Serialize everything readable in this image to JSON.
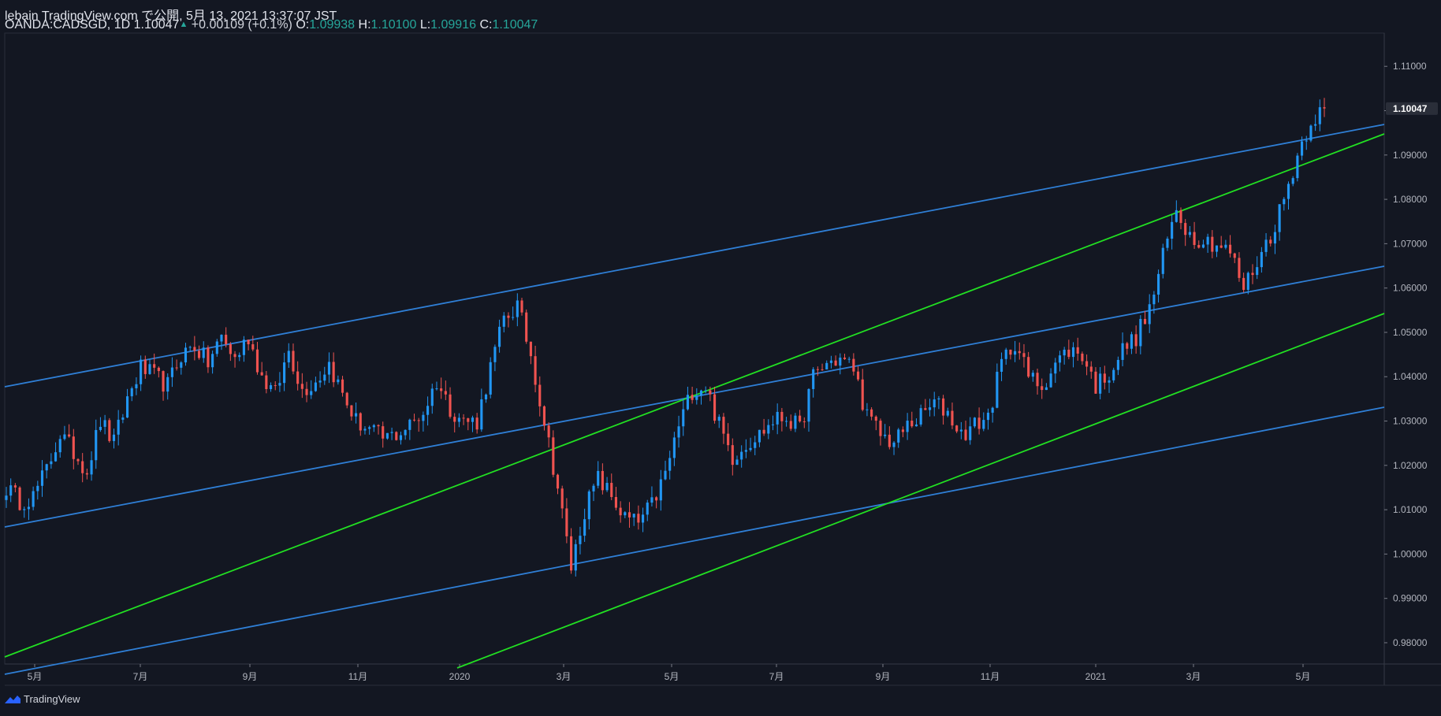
{
  "header": {
    "publish_line": "lebain TradingView.com で公開, 5月 13, 2021 13:37:07 JST",
    "symbol": "OANDA:CADSGD, 1D",
    "last": "1.10047",
    "change": "+0.00109 (+0.1%)",
    "o_label": "O:",
    "o_value": "1.09938",
    "h_label": "H:",
    "h_value": "1.10100",
    "l_label": "L:",
    "l_value": "1.09916",
    "c_label": "C:",
    "c_value": "1.10047"
  },
  "footer": {
    "logo_text": "TradingView"
  },
  "colors": {
    "background": "#131722",
    "up": "#2196f3",
    "down": "#f05350",
    "channel_blue": "#2f7fd6",
    "channel_green": "#22e022",
    "value_green": "#26a69a"
  },
  "chart_data": {
    "type": "candlestick",
    "ylim": [
      0.9752,
      1.1175
    ],
    "y_ticks": [
      "1.11000",
      "1.10000",
      "1.09000",
      "1.08000",
      "1.07000",
      "1.06000",
      "1.05000",
      "1.04000",
      "1.03000",
      "1.02000",
      "1.01000",
      "1.00000",
      "0.99000",
      "0.98000"
    ],
    "x_ticks": [
      "5月",
      "7月",
      "9月",
      "11月",
      "2020",
      "3月",
      "5月",
      "7月",
      "9月",
      "11月",
      "2021",
      "3月",
      "5月"
    ],
    "current_price_label": "1.10047",
    "series": [
      {
        "points": [
          [
            0,
            1.015
          ],
          [
            3,
            1.012
          ],
          [
            6,
            1.013
          ],
          [
            9,
            1.019
          ],
          [
            12,
            1.027
          ],
          [
            15,
            1.023
          ],
          [
            18,
            1.019
          ],
          [
            21,
            1.03
          ],
          [
            24,
            1.025
          ],
          [
            27,
            1.035
          ],
          [
            30,
            1.042
          ],
          [
            33,
            1.04
          ],
          [
            36,
            1.038
          ],
          [
            39,
            1.045
          ],
          [
            42,
            1.047
          ],
          [
            45,
            1.043
          ],
          [
            48,
            1.049
          ],
          [
            51,
            1.044
          ],
          [
            54,
            1.049
          ],
          [
            57,
            1.04
          ],
          [
            60,
            1.036
          ],
          [
            63,
            1.046
          ],
          [
            66,
            1.037
          ],
          [
            69,
            1.039
          ],
          [
            72,
            1.043
          ],
          [
            75,
            1.036
          ],
          [
            78,
            1.03
          ],
          [
            81,
            1.028
          ],
          [
            84,
            1.026
          ],
          [
            87,
            1.027
          ],
          [
            90,
            1.029
          ],
          [
            93,
            1.032
          ],
          [
            96,
            1.039
          ],
          [
            99,
            1.033
          ],
          [
            102,
            1.03
          ],
          [
            105,
            1.03
          ],
          [
            108,
            1.042
          ],
          [
            111,
            1.053
          ],
          [
            114,
            1.056
          ],
          [
            117,
            1.045
          ],
          [
            120,
            1.03
          ],
          [
            123,
            1.015
          ],
          [
            126,
            0.997
          ],
          [
            129,
            1.01
          ],
          [
            132,
            1.017
          ],
          [
            135,
            1.013
          ],
          [
            138,
            1.008
          ],
          [
            141,
            1.007
          ],
          [
            144,
            1.011
          ],
          [
            147,
            1.018
          ],
          [
            150,
            1.029
          ],
          [
            153,
            1.037
          ],
          [
            156,
            1.038
          ],
          [
            159,
            1.029
          ],
          [
            162,
            1.022
          ],
          [
            165,
            1.025
          ],
          [
            168,
            1.027
          ],
          [
            171,
            1.03
          ],
          [
            174,
            1.031
          ],
          [
            177,
            1.028
          ],
          [
            180,
            1.04
          ],
          [
            183,
            1.043
          ],
          [
            186,
            1.044
          ],
          [
            189,
            1.042
          ],
          [
            192,
            1.031
          ],
          [
            195,
            1.027
          ],
          [
            198,
            1.025
          ],
          [
            201,
            1.029
          ],
          [
            204,
            1.031
          ],
          [
            207,
            1.034
          ],
          [
            210,
            1.032
          ],
          [
            213,
            1.027
          ],
          [
            216,
            1.029
          ],
          [
            219,
            1.031
          ],
          [
            222,
            1.043
          ],
          [
            225,
            1.048
          ],
          [
            228,
            1.04
          ],
          [
            231,
            1.038
          ],
          [
            234,
            1.043
          ],
          [
            237,
            1.046
          ],
          [
            240,
            1.045
          ],
          [
            243,
            1.038
          ],
          [
            246,
            1.041
          ],
          [
            249,
            1.046
          ],
          [
            252,
            1.049
          ],
          [
            255,
            1.055
          ],
          [
            258,
            1.067
          ],
          [
            261,
            1.078
          ],
          [
            264,
            1.072
          ],
          [
            267,
            1.071
          ],
          [
            270,
            1.07
          ],
          [
            273,
            1.068
          ],
          [
            276,
            1.06
          ],
          [
            279,
            1.066
          ],
          [
            282,
            1.072
          ],
          [
            285,
            1.08
          ],
          [
            288,
            1.09
          ],
          [
            291,
            1.098
          ],
          [
            294,
            1.1005
          ]
        ]
      }
    ]
  }
}
